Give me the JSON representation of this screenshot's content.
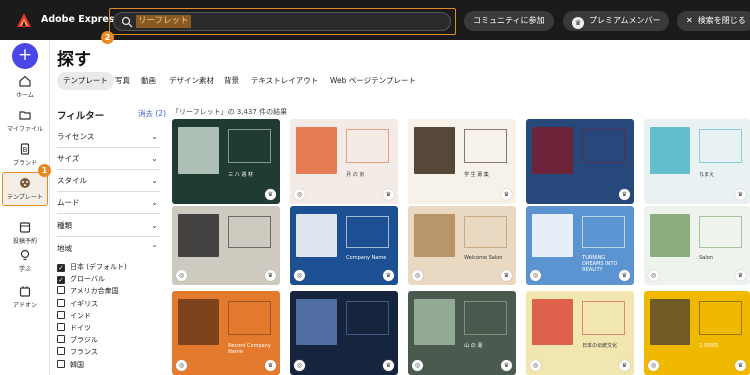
{
  "app": {
    "name": "Adobe Express"
  },
  "search": {
    "value": "リーフレット"
  },
  "header": {
    "community": "コミュニティに参加",
    "premium": "プレミアムメンバー",
    "close_search": "検索を閉じる"
  },
  "rail": {
    "create": "+",
    "items": [
      {
        "label": "ホーム",
        "icon": "home-icon"
      },
      {
        "label": "マイファイル",
        "icon": "folder-icon"
      },
      {
        "label": "ブランド",
        "icon": "brand-icon"
      },
      {
        "label": "テンプレート",
        "icon": "template-icon"
      },
      {
        "label": "投稿予約",
        "icon": "calendar-icon"
      },
      {
        "label": "学ぶ",
        "icon": "lightbulb-icon"
      },
      {
        "label": "アドオン",
        "icon": "addon-icon"
      }
    ]
  },
  "page": {
    "title": "探す"
  },
  "tabs": [
    "テンプレート",
    "写真",
    "動画",
    "デザイン素材",
    "背景",
    "テキストレイアウト",
    "Web ページテンプレート"
  ],
  "filters": {
    "title": "フィルター",
    "clear": "消去 (2)",
    "rows": [
      "ライセンス",
      "サイズ",
      "スタイル",
      "ムード",
      "種類"
    ],
    "region": "地域",
    "regions": [
      {
        "label": "日本 (デフォルト)",
        "checked": true
      },
      {
        "label": "グローバル",
        "checked": true
      },
      {
        "label": "アメリカ合衆国",
        "checked": false
      },
      {
        "label": "イギリス",
        "checked": false
      },
      {
        "label": "インド",
        "checked": false
      },
      {
        "label": "ドイツ",
        "checked": false
      },
      {
        "label": "ブラジル",
        "checked": false
      },
      {
        "label": "フランス",
        "checked": false
      },
      {
        "label": "韓国",
        "checked": false
      }
    ]
  },
  "results": {
    "text": "「リーフレット」の 3,437 件の結果"
  },
  "callouts": {
    "one": "1",
    "two": "2"
  },
  "cards": [
    {
      "text": "三 八 週 材"
    },
    {
      "text": "月 の 京"
    },
    {
      "text": "学 生 募 集"
    },
    {
      "text": ""
    },
    {
      "text": "なまえ"
    },
    {
      "text": ""
    },
    {
      "text": "Company Name"
    },
    {
      "text": "Welcome Salon"
    },
    {
      "text": "TURNING DREAMS INTO REALITY"
    },
    {
      "text": "Salon"
    },
    {
      "text": "Record Company Name"
    },
    {
      "text": ""
    },
    {
      "text": "山 の 湯"
    },
    {
      "text": "日本の伝統文化"
    },
    {
      "text": "2,500円"
    }
  ]
}
